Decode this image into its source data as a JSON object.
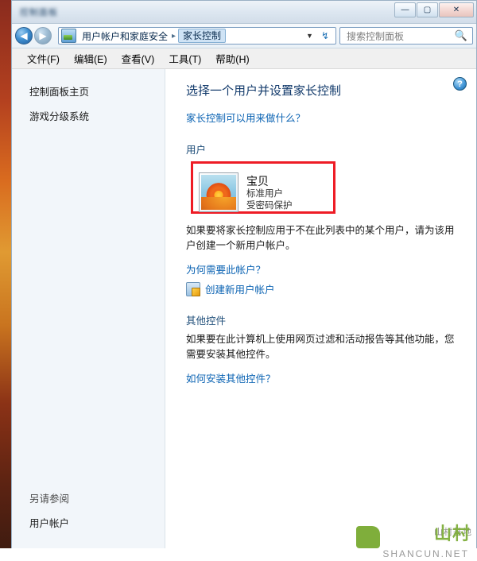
{
  "window": {
    "title_blurred": "控制面板",
    "buttons": {
      "minimize": "—",
      "maximize": "▢",
      "close": "✕"
    }
  },
  "navbar": {
    "back_icon": "◀",
    "forward_icon": "▶",
    "breadcrumb": [
      {
        "label": "用户帐户和家庭安全",
        "selected": false
      },
      {
        "label": "家长控制",
        "selected": true
      }
    ],
    "separator": "▸",
    "dropdown_icon": "▼",
    "refresh_icon": "↯",
    "search_placeholder": "搜索控制面板",
    "search_icon": "🔍",
    "search_value": ""
  },
  "menubar": {
    "items": [
      "文件(F)",
      "编辑(E)",
      "查看(V)",
      "工具(T)",
      "帮助(H)"
    ]
  },
  "sidebar": {
    "items": [
      "控制面板主页",
      "游戏分级系统"
    ],
    "bottom_heading": "另请参阅",
    "bottom_items": [
      "用户帐户"
    ]
  },
  "main": {
    "help_icon": "?",
    "page_title": "选择一个用户并设置家长控制",
    "intro_link": "家长控制可以用来做什么？",
    "users_section": {
      "heading": "用户",
      "user": {
        "name": "宝贝",
        "type": "标准用户",
        "protection": "受密码保护",
        "avatar_icon": "flower-avatar",
        "highlight_color": "#ee1c25"
      },
      "note": "如果要将家长控制应用于不在此列表中的某个用户，请为该用户创建一个新用户帐户。",
      "links": [
        {
          "label": "为何需要此帐户？",
          "icon": ""
        },
        {
          "label": "创建新用户帐户",
          "icon": "shield-icon"
        }
      ]
    },
    "other_section": {
      "heading": "其他控件",
      "note": "如果要在此计算机上使用网页过滤和活动报告等其他功能，您需要安装其他控件。",
      "links": [
        {
          "label": "如何安装其他控件？"
        }
      ]
    }
  },
  "watermark": {
    "logo": "山村",
    "site": "SHANCUN.NET",
    "cn": "山村基地"
  }
}
